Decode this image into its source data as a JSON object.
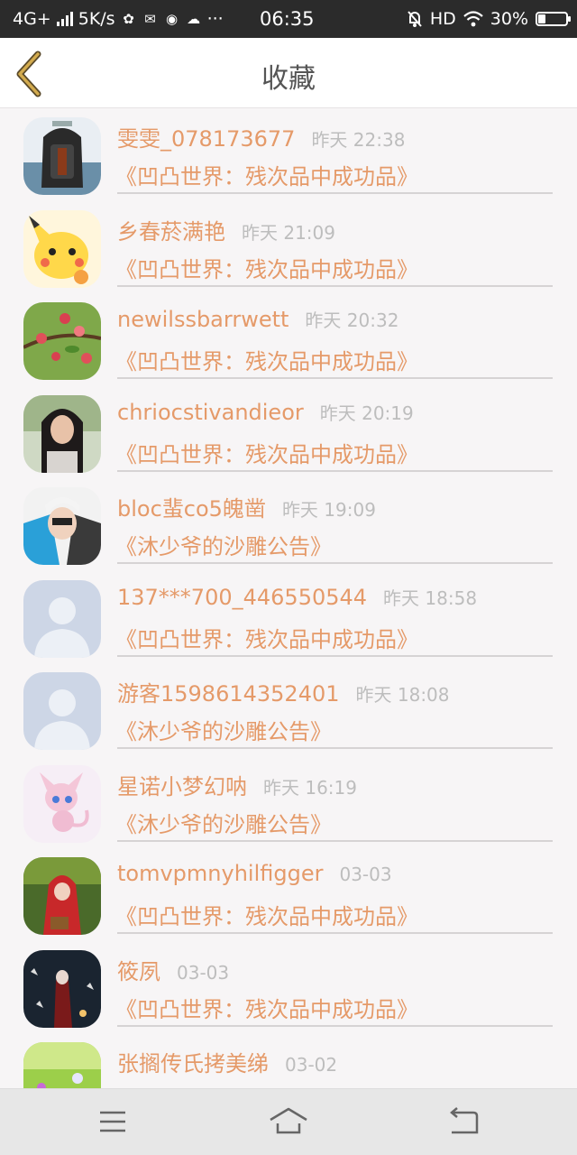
{
  "status_bar": {
    "network": "4G+",
    "speed": "5K/s",
    "time": "06:35",
    "hd": "HD",
    "battery": "30%",
    "battery_level": 0.3
  },
  "header": {
    "title": "收藏",
    "back_icon": "chevron-left-icon"
  },
  "list": [
    {
      "name": "雯雯_078173677",
      "time": "昨天 22:38",
      "title": "《凹凸世界：残次品中成功品》",
      "avatar": "backpack"
    },
    {
      "name": "乡春菸满艳",
      "time": "昨天 21:09",
      "title": "《凹凸世界：残次品中成功品》",
      "avatar": "pikachu"
    },
    {
      "name": "newilssbarrwett",
      "time": "昨天 20:32",
      "title": "《凹凸世界：残次品中成功品》",
      "avatar": "flowers"
    },
    {
      "name": "chriocstivandieor",
      "time": "昨天 20:19",
      "title": "《凹凸世界：残次品中成功品》",
      "avatar": "girl"
    },
    {
      "name": "bloc蜚co5魄凿",
      "time": "昨天 19:09",
      "title": "《沐少爷的沙雕公告》",
      "avatar": "boy"
    },
    {
      "name": "137***700_446550544",
      "time": "昨天 18:58",
      "title": "《凹凸世界：残次品中成功品》",
      "avatar": "default"
    },
    {
      "name": "游客1598614352401",
      "time": "昨天 18:08",
      "title": "《沐少爷的沙雕公告》",
      "avatar": "default"
    },
    {
      "name": "星诺小梦幻呐",
      "time": "昨天 16:19",
      "title": "《沐少爷的沙雕公告》",
      "avatar": "mew"
    },
    {
      "name": "tomvpmnyhilfigger",
      "time": "03-03",
      "title": "《凹凸世界：残次品中成功品》",
      "avatar": "redhood"
    },
    {
      "name": "筱夙",
      "time": "03-03",
      "title": "《凹凸世界：残次品中成功品》",
      "avatar": "dark"
    },
    {
      "name": "张搁传氏拷美绨",
      "time": "03-02",
      "title": "",
      "avatar": "meadow"
    }
  ],
  "nav": {
    "menu_icon": "menu-icon",
    "home_icon": "home-icon",
    "back_icon": "back-icon"
  },
  "colors": {
    "accent": "#e59a69",
    "time_gray": "#bdbdbd",
    "back_arrow": "#c8a34a",
    "status_bar_bg": "#2b2b2b"
  }
}
